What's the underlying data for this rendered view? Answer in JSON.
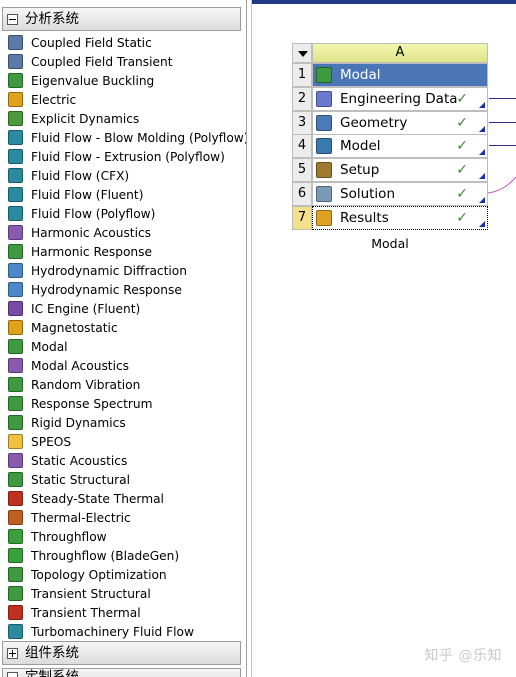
{
  "toolbox": {
    "group_analysis": "分析系统",
    "systems": [
      {
        "label": "Coupled Field Static",
        "icon": "coupled-static-icon",
        "color": "#5a7aa8"
      },
      {
        "label": "Coupled Field Transient",
        "icon": "coupled-transient-icon",
        "color": "#5a7aa8"
      },
      {
        "label": "Eigenvalue Buckling",
        "icon": "buckling-icon",
        "color": "#3e9a3e"
      },
      {
        "label": "Electric",
        "icon": "electric-icon",
        "color": "#e0a21a"
      },
      {
        "label": "Explicit Dynamics",
        "icon": "explicit-dynamics-icon",
        "color": "#4a9a3a"
      },
      {
        "label": "Fluid Flow - Blow Molding (Polyflow)",
        "icon": "fluid-flow-icon",
        "color": "#2a8aa0"
      },
      {
        "label": "Fluid Flow - Extrusion (Polyflow)",
        "icon": "fluid-flow-icon",
        "color": "#2a8aa0"
      },
      {
        "label": "Fluid Flow (CFX)",
        "icon": "fluid-flow-icon",
        "color": "#2a8aa0"
      },
      {
        "label": "Fluid Flow (Fluent)",
        "icon": "fluid-flow-icon",
        "color": "#2a8aa0"
      },
      {
        "label": "Fluid Flow (Polyflow)",
        "icon": "fluid-flow-icon",
        "color": "#2a8aa0"
      },
      {
        "label": "Harmonic Acoustics",
        "icon": "acoustics-icon",
        "color": "#8a5ab0"
      },
      {
        "label": "Harmonic Response",
        "icon": "harmonic-icon",
        "color": "#3e9a3e"
      },
      {
        "label": "Hydrodynamic Diffraction",
        "icon": "hydrodynamic-icon",
        "color": "#4a8ac8"
      },
      {
        "label": "Hydrodynamic Response",
        "icon": "hydrodynamic-icon",
        "color": "#4a8ac8"
      },
      {
        "label": "IC Engine (Fluent)",
        "icon": "ic-engine-icon",
        "color": "#7a4aa8"
      },
      {
        "label": "Magnetostatic",
        "icon": "magnet-icon",
        "color": "#e0a21a"
      },
      {
        "label": "Modal",
        "icon": "modal-icon",
        "color": "#3e9a3e"
      },
      {
        "label": "Modal Acoustics",
        "icon": "acoustics-icon",
        "color": "#8a5ab0"
      },
      {
        "label": "Random Vibration",
        "icon": "vibration-icon",
        "color": "#3e9a3e"
      },
      {
        "label": "Response Spectrum",
        "icon": "spectrum-icon",
        "color": "#3e9a3e"
      },
      {
        "label": "Rigid Dynamics",
        "icon": "rigid-dynamics-icon",
        "color": "#3e9a3e"
      },
      {
        "label": "SPEOS",
        "icon": "speos-icon",
        "color": "#f0c040"
      },
      {
        "label": "Static Acoustics",
        "icon": "acoustics-icon",
        "color": "#8a5ab0"
      },
      {
        "label": "Static Structural",
        "icon": "structural-icon",
        "color": "#3e9a3e"
      },
      {
        "label": "Steady-State Thermal",
        "icon": "thermal-icon",
        "color": "#c03020"
      },
      {
        "label": "Thermal-Electric",
        "icon": "thermal-electric-icon",
        "color": "#c06020"
      },
      {
        "label": "Throughflow",
        "icon": "throughflow-icon",
        "color": "#3aa03a"
      },
      {
        "label": "Throughflow (BladeGen)",
        "icon": "throughflow-icon",
        "color": "#3aa03a"
      },
      {
        "label": "Topology Optimization",
        "icon": "topology-icon",
        "color": "#3e9a3e"
      },
      {
        "label": "Transient Structural",
        "icon": "structural-icon",
        "color": "#3e9a3e"
      },
      {
        "label": "Transient Thermal",
        "icon": "thermal-icon",
        "color": "#c03020"
      },
      {
        "label": "Turbomachinery Fluid Flow",
        "icon": "turbo-icon",
        "color": "#2a8aa0"
      }
    ],
    "group_components": "组件系统",
    "group_custom": "定制系统"
  },
  "schematic": {
    "column_header": "A",
    "caption": "Modal",
    "rows": [
      {
        "num": "1",
        "label": "Modal",
        "icon": "modal-icon",
        "status": ""
      },
      {
        "num": "2",
        "label": "Engineering Data",
        "icon": "engineering-data-icon",
        "status": "✓"
      },
      {
        "num": "3",
        "label": "Geometry",
        "icon": "geometry-icon",
        "status": "✓"
      },
      {
        "num": "4",
        "label": "Model",
        "icon": "model-icon",
        "status": "✓"
      },
      {
        "num": "5",
        "label": "Setup",
        "icon": "setup-icon",
        "status": "✓"
      },
      {
        "num": "6",
        "label": "Solution",
        "icon": "solution-icon",
        "status": "✓"
      },
      {
        "num": "7",
        "label": "Results",
        "icon": "results-icon",
        "status": "✓"
      }
    ]
  },
  "watermark": "知乎 @乐知",
  "colors": {
    "title_row": "#4a76b8",
    "header_yellow": "#e6ea96",
    "check_green": "#3a8a2a"
  }
}
